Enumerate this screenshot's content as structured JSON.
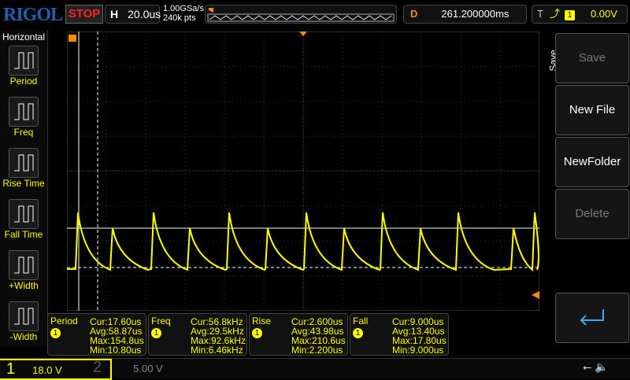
{
  "top": {
    "logo": "RIGOL",
    "run_state": "STOP",
    "h_label": "H",
    "timebase": "20.0us",
    "sample_rate": "1.00GSa/s",
    "memory_depth": "240k pts",
    "d_label": "D",
    "delay": "261.200000ms",
    "t_label": "T",
    "trigger_source": "1",
    "trigger_level": "0.00V"
  },
  "left_menu": {
    "title": "Horizontal",
    "items": [
      {
        "label": "Period",
        "icon": "period-icon"
      },
      {
        "label": "Freq",
        "icon": "freq-icon"
      },
      {
        "label": "Rise Time",
        "icon": "rise-time-icon"
      },
      {
        "label": "Fall Time",
        "icon": "fall-time-icon"
      },
      {
        "label": "+Width",
        "icon": "pos-width-icon"
      },
      {
        "label": "-Width",
        "icon": "neg-width-icon"
      }
    ]
  },
  "right_menu": {
    "title": "Save",
    "buttons": [
      {
        "label": "Save",
        "enabled": false
      },
      {
        "label": "New File",
        "enabled": true
      },
      {
        "label": "NewFolder",
        "enabled": true
      },
      {
        "label": "Delete",
        "enabled": false
      }
    ],
    "enter_icon": "enter-icon"
  },
  "measurements": [
    {
      "name": "Period",
      "src": "1",
      "cur": "Cur:17.60us",
      "avg": "Avg:58.87us",
      "max": "Max:154.8us",
      "min": "Min:10.80us"
    },
    {
      "name": "Freq",
      "src": "1",
      "cur": "Cur:56.8kHz",
      "avg": "Avg:29.5kHz",
      "max": "Max:92.6kHz",
      "min": "Min:6.46kHz"
    },
    {
      "name": "Rise",
      "src": "1",
      "cur": "Cur:2.600us",
      "avg": "Avg:43.98us",
      "max": "Max:210.6us",
      "min": "Min:2.200us"
    },
    {
      "name": "Fall",
      "src": "1",
      "cur": "Cur:9.000us",
      "avg": "Avg:13.40us",
      "max": "Max:17.80us",
      "min": "Min:9.000us"
    }
  ],
  "channels": [
    {
      "num": "1",
      "scale": "18.0 V",
      "active": true
    },
    {
      "num": "2",
      "scale": "5.00 V",
      "active": false
    }
  ],
  "colors": {
    "ch1": "#ffff00",
    "trigger": "#ff8c00",
    "accent": "#1e5fb0"
  }
}
